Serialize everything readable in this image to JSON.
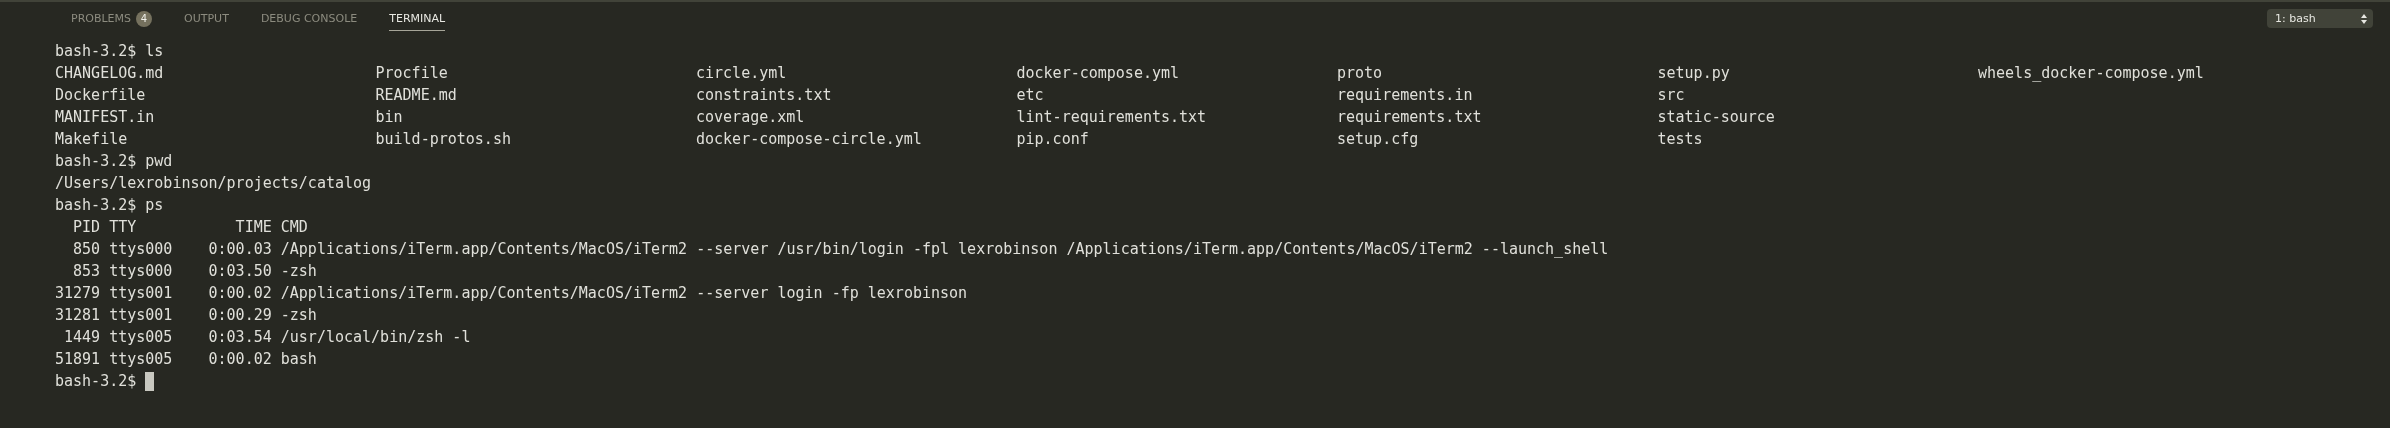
{
  "panel_tabs": [
    {
      "label": "PROBLEMS",
      "badge": "4",
      "selected": false
    },
    {
      "label": "OUTPUT",
      "selected": false
    },
    {
      "label": "DEBUG CONSOLE",
      "selected": false
    },
    {
      "label": "TERMINAL",
      "selected": true
    }
  ],
  "terminal_selector": {
    "value": "1: bash"
  },
  "terminal": {
    "lines": [
      {
        "kind": "prompt",
        "prompt": "bash-3.2$",
        "command": "ls",
        "cursor": false
      },
      {
        "kind": "grid",
        "rows": [
          [
            "CHANGELOG.md",
            "Procfile",
            "circle.yml",
            "docker-compose.yml",
            "proto",
            "setup.py",
            "wheels_docker-compose.yml"
          ],
          [
            "Dockerfile",
            "README.md",
            "constraints.txt",
            "etc",
            "requirements.in",
            "src"
          ],
          [
            "MANIFEST.in",
            "bin",
            "coverage.xml",
            "lint-requirements.txt",
            "requirements.txt",
            "static-source"
          ],
          [
            "Makefile",
            "build-protos.sh",
            "docker-compose-circle.yml",
            "pip.conf",
            "setup.cfg",
            "tests"
          ]
        ]
      },
      {
        "kind": "prompt",
        "prompt": "bash-3.2$",
        "command": "pwd",
        "cursor": false
      },
      {
        "kind": "output",
        "text": "/Users/lexrobinson/projects/catalog"
      },
      {
        "kind": "prompt",
        "prompt": "bash-3.2$",
        "command": "ps",
        "cursor": false
      },
      {
        "kind": "output",
        "text": "  PID TTY           TIME CMD"
      },
      {
        "kind": "output",
        "text": "  850 ttys000    0:00.03 /Applications/iTerm.app/Contents/MacOS/iTerm2 --server /usr/bin/login -fpl lexrobinson /Applications/iTerm.app/Contents/MacOS/iTerm2 --launch_shell"
      },
      {
        "kind": "output",
        "text": "  853 ttys000    0:03.50 -zsh"
      },
      {
        "kind": "output",
        "text": "31279 ttys001    0:00.02 /Applications/iTerm.app/Contents/MacOS/iTerm2 --server login -fp lexrobinson"
      },
      {
        "kind": "output",
        "text": "31281 ttys001    0:00.29 -zsh"
      },
      {
        "kind": "output",
        "text": " 1449 ttys005    0:03.54 /usr/local/bin/zsh -l"
      },
      {
        "kind": "output",
        "text": "51891 ttys005    0:00.02 bash"
      },
      {
        "kind": "prompt",
        "prompt": "bash-3.2$",
        "cursor": true
      }
    ]
  }
}
